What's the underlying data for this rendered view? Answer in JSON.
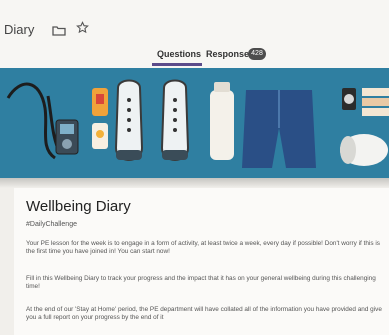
{
  "app": {
    "title": "Diary"
  },
  "tabs": [
    {
      "label": "Questions"
    },
    {
      "label": "Responses",
      "badge": "428"
    }
  ],
  "form": {
    "title": "Wellbeing Diary",
    "hashtag": "#DailyChallenge",
    "paragraphs": [
      "Your PE lesson for the week is to engage in a form of activity, at least twice a week, every day if possible! Don't worry if this is the first time you have joined in! You can start now!",
      "Fill in this Wellbeing Diary to track your progress and the impact that it has on your general wellbeing during this challenging time!",
      "At the end of our 'Stay at Home' period, the PE department will have collated all of the information you have provided and give you a full report on your progress by the end of it"
    ]
  },
  "colors": {
    "banner": "#2f7fa1",
    "accent": "#5b4b8a"
  },
  "icons": {
    "folder": "folder-icon",
    "star": "star-icon"
  }
}
